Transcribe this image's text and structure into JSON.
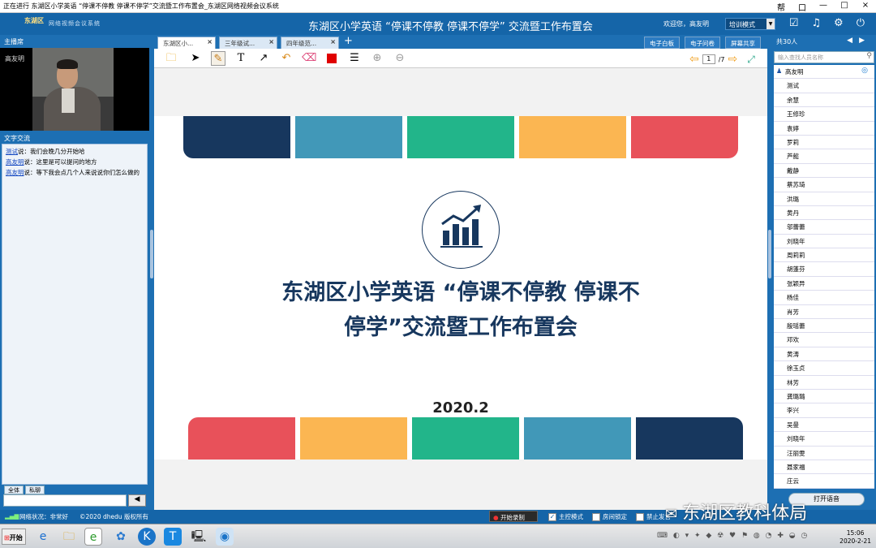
{
  "window": {
    "title": "正在进行 东湖区小学英语 “停课不停教 停课不停学”交流暨工作布置会_东湖区网络视频会议系统",
    "controls": [
      "帮",
      "口",
      "—",
      "□",
      "×"
    ]
  },
  "header": {
    "logo_text": "东湖区",
    "logo_sub": "网络视频会议系统",
    "title": "东湖区小学英语 “停课不停教 停课不停学” 交流暨工作布置会",
    "welcome": "欢迎您，高友明",
    "mode_select": "培训模式",
    "icons": [
      "check-icon",
      "music-icon",
      "gear-icon",
      "power-icon"
    ]
  },
  "left": {
    "host_label": "主播席",
    "host_name": "高友明",
    "chat_label": "文字交流",
    "messages": [
      {
        "user": "测试",
        "text": "说：我们会晚几分开始哈"
      },
      {
        "user": "高友明",
        "text": "说：这里是可以提问的地方"
      },
      {
        "user": "高友明",
        "text": "说：等下我会点几个人来说说你们怎么做的"
      }
    ],
    "tabs": [
      "全体",
      "私聊"
    ],
    "send_label": "◀"
  },
  "center": {
    "tabs": [
      {
        "label": "东湖区小...",
        "active": true
      },
      {
        "label": "三年级试...",
        "active": false
      },
      {
        "label": "四年级范...",
        "active": false
      }
    ],
    "add_tab": "+",
    "right_tabs": [
      "电子白板",
      "电子问卷",
      "屏幕共享"
    ],
    "tools": [
      "folder-icon",
      "pointer-icon",
      "pencil-icon",
      "text-icon",
      "arrow-icon",
      "undo-icon",
      "eraser-icon",
      "color-icon",
      "linewidth-icon",
      "zoom-in-icon",
      "zoom-out-icon"
    ],
    "page_current": "1",
    "page_total": "/7",
    "slide": {
      "title": "东湖区小学英语 “停课不停教 停课不停学”交流暨工作布置会",
      "title_line1": "东湖区小学英语 “停课不停教 停课不",
      "title_line2": "停学”交流暨工作布置会",
      "date": "2020.2",
      "top_colors": [
        "#17375e",
        "#4198b8",
        "#22b58a",
        "#fbb652",
        "#e8515a"
      ],
      "bottom_colors": [
        "#e8515a",
        "#fbb652",
        "#22b58a",
        "#4198b8",
        "#17375e"
      ]
    }
  },
  "right": {
    "count_label": "共30人",
    "search_placeholder": "输入查找人员名称",
    "users": [
      "高友明",
      "测试",
      "余慧",
      "王修珍",
      "袁婷",
      "罗莉",
      "芦懿",
      "戴静",
      "蔡苏琦",
      "洪璐",
      "黄丹",
      "邬蕾蕾",
      "刘晓年",
      "周莉莉",
      "胡蓬芬",
      "张颖异",
      "杨佳",
      "肖芳",
      "殷瑶蕾",
      "邓欢",
      "黄涛",
      "徐玉贞",
      "林芳",
      "龚璐璐",
      "李兴",
      "吴曼",
      "刘晓年",
      "汪丽雯",
      "聂家福",
      "庄云"
    ],
    "bottom_button": "打开语音"
  },
  "status": {
    "network": "网络状况：非常好",
    "copyright": "©2020  dhedu 版权所有",
    "record": "开始录制",
    "main_control": "主控模式",
    "room_lock": "房间锁定",
    "disable": "禁止发言"
  },
  "watermark": "东湖区教科体局",
  "taskbar": {
    "start": "开始",
    "time": "15:06",
    "date": "2020-2-21"
  }
}
